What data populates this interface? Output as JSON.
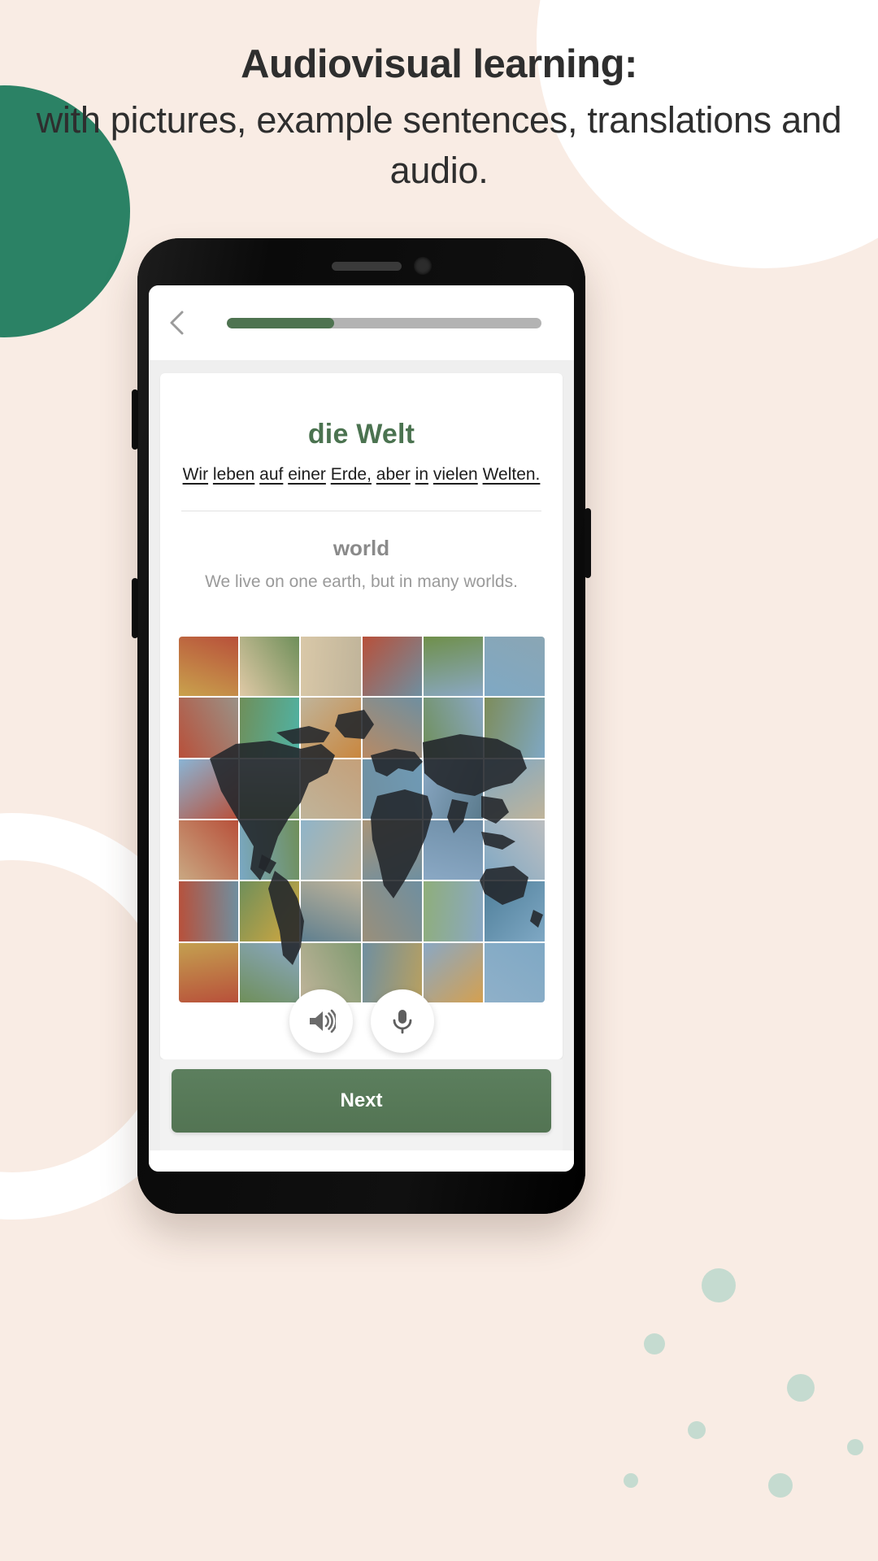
{
  "theme": {
    "background": "#f9ece4",
    "accent_green": "#4b7350",
    "blob_green": "#2b8265",
    "dot_mint": "#c5dbd0",
    "muted_gray": "#9a9a9a"
  },
  "headline": {
    "line1": "Audiovisual learning:",
    "line2": "with pictures, example sentences, translations and audio."
  },
  "phone": {
    "app": {
      "topbar": {
        "back_icon": "chevron-left-icon",
        "progress_percent": 34,
        "progress_label": "34%"
      },
      "card": {
        "term": "die Welt",
        "sentence_de_words": [
          "Wir",
          "leben",
          "auf",
          "einer",
          "Erde,",
          "aber",
          "in",
          "vielen",
          "Welten."
        ],
        "translation": "world",
        "sentence_en": "We live on one earth, but in many worlds.",
        "audio_button_icon": "speaker-icon",
        "mic_button_icon": "microphone-icon",
        "image_alt": "world map photo mosaic"
      },
      "next_label": "Next"
    }
  },
  "mosaic_tiles": [
    "#c9a24d",
    "#e0c9a6",
    "#d9c8a8",
    "#b8503a",
    "#6f8f4a",
    "#8aa6b4",
    "#9a9287",
    "#4fb3a5",
    "#c9873f",
    "#b88a64",
    "#6f8f5a",
    "#7d8c5a",
    "#8ab4d4",
    "#a8b8c0",
    "#c4a07a",
    "#6f9ab5",
    "#5a7a8c",
    "#c0b49a",
    "#c9a882",
    "#7aa8c4",
    "#8fb4c9",
    "#a89478",
    "#6f8fa8",
    "#bcbec0",
    "#6f8fa0",
    "#d4a83f",
    "#5f7f8f",
    "#9a8f7a",
    "#8fae7a",
    "#4f7f9a",
    "#c4a050",
    "#8aa8c4",
    "#7f9a70",
    "#b8a060",
    "#d4a050",
    "#8fb0c9",
    "#b84f3a",
    "#a89a7a",
    "#7fa8c4",
    "#c9b08a",
    "#6f8f7a",
    "#cfa86a"
  ]
}
